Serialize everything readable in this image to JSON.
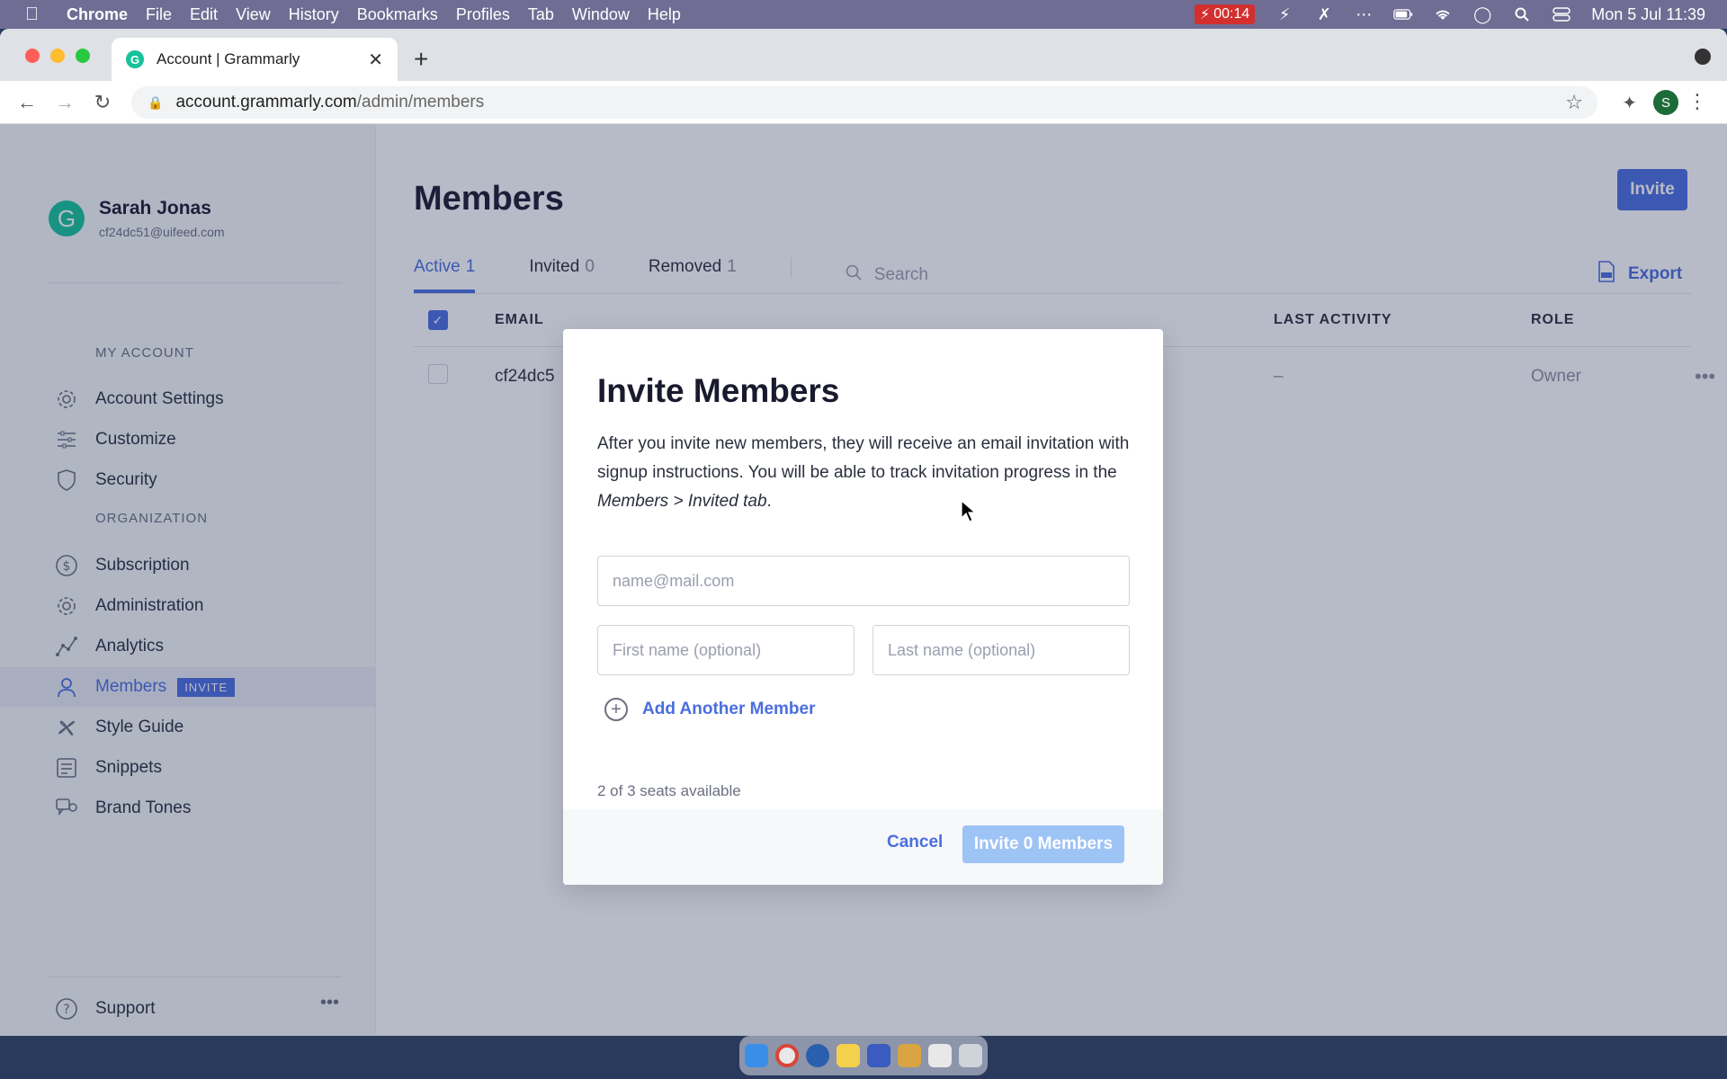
{
  "menubar": {
    "app": "Chrome",
    "items": [
      "File",
      "Edit",
      "View",
      "History",
      "Bookmarks",
      "Profiles",
      "Tab",
      "Window",
      "Help"
    ],
    "timer": "00:14",
    "datetime": "Mon 5 Jul  11:39"
  },
  "browser": {
    "tab_title": "Account | Grammarly",
    "url_host": "account.grammarly.com",
    "url_path": "/admin/members",
    "profile_initial": "S"
  },
  "sidebar": {
    "user_name": "Sarah Jonas",
    "user_email": "cf24dc51@uifeed.com",
    "avatar_letter": "G",
    "my_account_label": "MY ACCOUNT",
    "organization_label": "ORGANIZATION",
    "items": [
      {
        "label": "Account Settings",
        "icon": "gear-icon"
      },
      {
        "label": "Customize",
        "icon": "sliders-icon"
      },
      {
        "label": "Security",
        "icon": "shield-icon"
      },
      {
        "label": "Subscription",
        "icon": "dollar-icon"
      },
      {
        "label": "Administration",
        "icon": "gear-icon"
      },
      {
        "label": "Analytics",
        "icon": "chart-icon"
      },
      {
        "label": "Members",
        "icon": "user-icon",
        "badge": "INVITE"
      },
      {
        "label": "Style Guide",
        "icon": "style-icon"
      },
      {
        "label": "Snippets",
        "icon": "snippets-icon"
      },
      {
        "label": "Brand Tones",
        "icon": "brand-tones-icon"
      }
    ],
    "support_label": "Support"
  },
  "main": {
    "title": "Members",
    "invite_label": "Invite",
    "export_label": "Export",
    "tabs": [
      {
        "label": "Active",
        "count": "1"
      },
      {
        "label": "Invited",
        "count": "0"
      },
      {
        "label": "Removed",
        "count": "1"
      }
    ],
    "search_placeholder": "Search",
    "columns": {
      "email": "EMAIL",
      "last_activity": "LAST ACTIVITY",
      "role": "ROLE"
    },
    "row": {
      "email": "cf24dc5",
      "last_activity": "–",
      "role": "Owner"
    }
  },
  "modal": {
    "title": "Invite Members",
    "desc_plain": "After you invite new members, they will receive an email invitation with signup instructions. You will be able to track invitation progress in the ",
    "desc_italic": "Members > Invited tab",
    "desc_end": ".",
    "email_placeholder": "name@mail.com",
    "first_name_placeholder": "First name (optional)",
    "last_name_placeholder": "Last name (optional)",
    "add_member_label": "Add Another Member",
    "seats_text": "2 of 3 seats available",
    "cancel_label": "Cancel",
    "confirm_label": "Invite 0 Members"
  },
  "colors": {
    "accent": "#4a6ee0",
    "grammarly_green": "#15c39a",
    "confirm_disabled": "#9ec3f5"
  }
}
